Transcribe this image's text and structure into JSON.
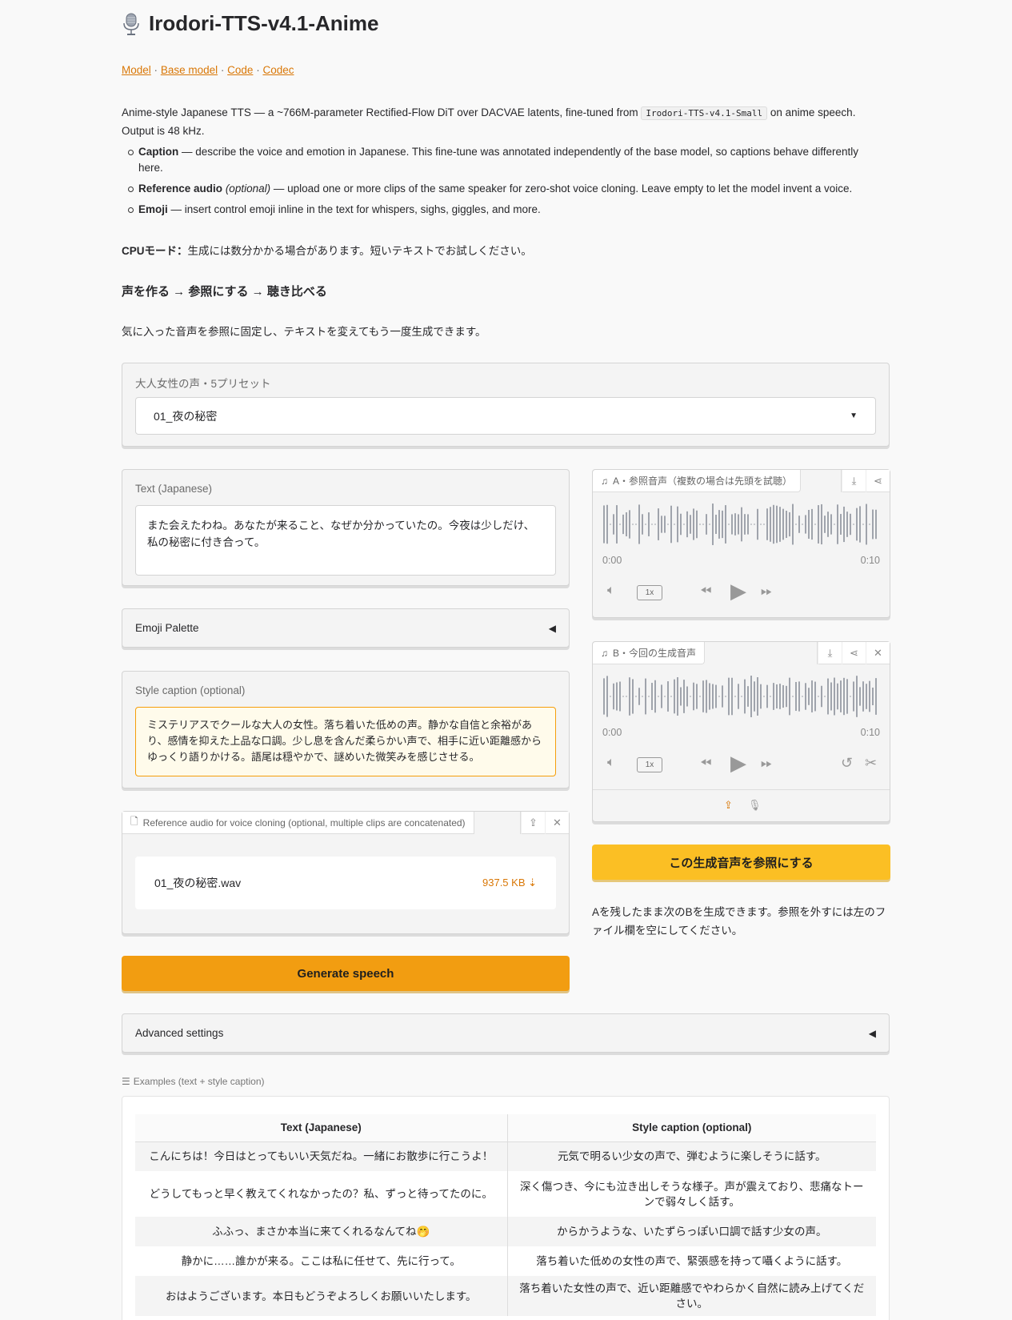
{
  "app": {
    "title": "Irodori-TTS-v4.1-Anime"
  },
  "links": {
    "model": "Model",
    "base_model": "Base model",
    "code": "Code",
    "codec": "Codec",
    "sep": "·"
  },
  "intro": {
    "before_code": "Anime-style Japanese TTS — a ~766M-parameter Rectified-Flow DiT over DACVAE latents, fine-tuned from",
    "code": "Irodori-TTS-v4.1-Small",
    "after_code": "on anime speech. Output is 48 kHz."
  },
  "bullets": [
    {
      "term": "Caption",
      "opt": "",
      "desc": " — describe the voice and emotion in Japanese. This fine-tune was annotated independently of the base model, so captions behave differently here."
    },
    {
      "term": "Reference audio",
      "opt": "(optional)",
      "desc": " — upload one or more clips of the same speaker for zero-shot voice cloning. Leave empty to let the model invent a voice."
    },
    {
      "term": "Emoji",
      "opt": "",
      "desc": " — insert control emoji inline in the text for whispers, sighs, giggles, and more."
    }
  ],
  "cpu": {
    "label": "CPUモード：",
    "text": "生成には数分かかる場合があります。短いテキストでお試しください。"
  },
  "flow_heading": "声を作る → 参照にする → 聴き比べる",
  "flow_note": "気に入った音声を参照に固定し、テキストを変えてもう一度生成できます。",
  "preset": {
    "label": "大人女性の声・5プリセット",
    "value": "01_夜の秘密"
  },
  "text_input": {
    "label": "Text (Japanese)",
    "value": "また会えたわね。あなたが来ること、なぜか分かっていたの。今夜は少しだけ、私の秘密に付き合って。"
  },
  "emoji_palette": {
    "label": "Emoji Palette"
  },
  "style_caption": {
    "label": "Style caption (optional)",
    "value": "ミステリアスでクールな大人の女性。落ち着いた低めの声。静かな自信と余裕があり、感情を抑えた上品な口調。少し息を含んだ柔らかい声で、相手に近い距離感からゆっくり語りかける。語尾は穏やかで、謎めいた微笑みを感じさせる。"
  },
  "reference_upload": {
    "label": "Reference audio for voice cloning (optional, multiple clips are concatenated)",
    "file_name": "01_夜の秘密.wav",
    "file_size": "937.5 KB ⇣"
  },
  "generate_button": "Generate speech",
  "audio_a": {
    "label": "A・参照音声（複数の場合は先頭を試聴）",
    "time_start": "0:00",
    "time_end": "0:10",
    "rate": "1x"
  },
  "audio_b": {
    "label": "B・今回の生成音声",
    "time_start": "0:00",
    "time_end": "0:10",
    "rate": "1x"
  },
  "use_as_reference_button": "この生成音声を参照にする",
  "reference_hint": "Aを残したまま次のBを生成できます。参照を外すには左のファイル欄を空にしてください。",
  "advanced": {
    "label": "Advanced settings"
  },
  "examples": {
    "label": "Examples (text + style caption)",
    "headers": [
      "Text (Japanese)",
      "Style caption (optional)"
    ],
    "rows": [
      [
        "こんにちは！今日はとってもいい天気だね。一緒にお散歩に行こうよ！",
        "元気で明るい少女の声で、弾むように楽しそうに話す。"
      ],
      [
        "どうしてもっと早く教えてくれなかったの？私、ずっと待ってたのに。",
        "深く傷つき、今にも泣き出しそうな様子。声が震えており、悲痛なトーンで弱々しく話す。"
      ],
      [
        "ふふっ、まさか本当に来てくれるなんてね🤭",
        "からかうような、いたずらっぽい口調で話す少女の声。"
      ],
      [
        "静かに……誰かが来る。ここは私に任せて、先に行って。",
        "落ち着いた低めの女性の声で、緊張感を持って囁くように話す。"
      ],
      [
        "おはようございます。本日もどうぞよろしくお願いいたします。",
        "落ち着いた女性の声で、近い距離感でやわらかく自然に読み上げてください。"
      ]
    ]
  },
  "colors": {
    "accent": "#f29d11",
    "accent_yellow": "#fbbf24",
    "link": "#d97706",
    "caption_bg": "#fffbeb",
    "caption_border": "#f59e0b"
  }
}
